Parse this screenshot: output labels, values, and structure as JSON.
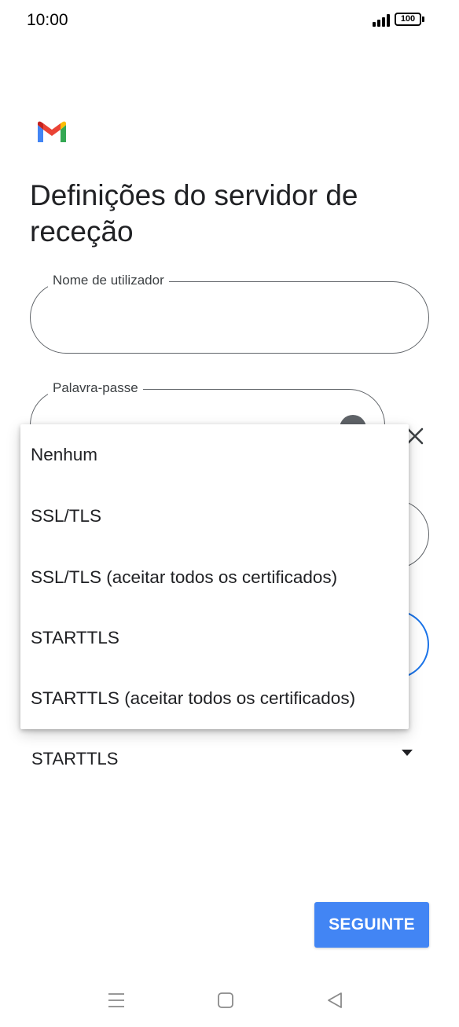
{
  "status_bar": {
    "time": "10:00",
    "battery": "100",
    "icons": [
      "signal-icon",
      "battery-icon"
    ]
  },
  "app": {
    "logo": "gmail-logo",
    "title": "Definições do servidor de receção"
  },
  "form": {
    "username": {
      "label": "Nome de utilizador",
      "value": ""
    },
    "password": {
      "label": "Palavra-passe",
      "value": "",
      "toggle_icon": "eye-icon",
      "clear_icon": "close-icon"
    },
    "security_type": {
      "selected": "STARTTLS",
      "icon": "dropdown-arrow-icon"
    }
  },
  "dropdown": {
    "options": [
      "Nenhum",
      "SSL/TLS",
      "SSL/TLS (aceitar todos os certificados)",
      "STARTTLS",
      "STARTTLS (aceitar todos os certificados)"
    ]
  },
  "actions": {
    "next_label": "SEGUINTE"
  },
  "nav_bar": {
    "icons": [
      "menu-icon",
      "home-icon",
      "back-icon"
    ]
  },
  "colors": {
    "accent": "#4285f4",
    "focus": "#1a73e8",
    "outline": "#5f6368"
  }
}
